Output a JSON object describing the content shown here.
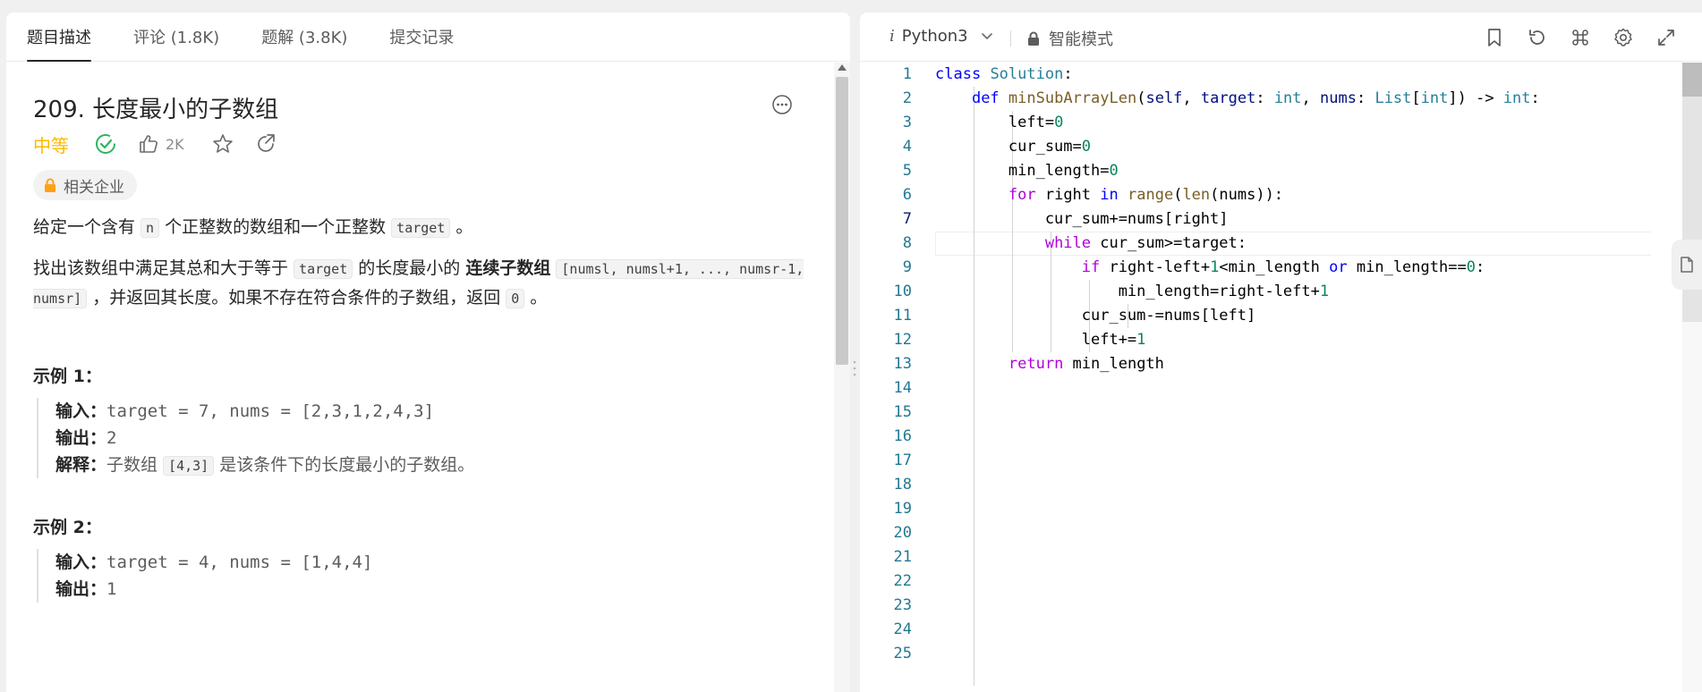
{
  "tabs": [
    {
      "label": "题目描述"
    },
    {
      "label": "评论 (1.8K)"
    },
    {
      "label": "题解 (3.8K)"
    },
    {
      "label": "提交记录"
    }
  ],
  "problem": {
    "title": "209. 长度最小的子数组",
    "difficulty": "中等",
    "difficulty_color": "#ffb800",
    "likes": "2K",
    "company_tag": "相关企业",
    "desc1_a": "给定一个含有 ",
    "desc1_code1": "n",
    "desc1_b": " 个正整数的数组和一个正整数 ",
    "desc1_code2": "target",
    "desc1_c": " 。",
    "desc2_a": "找出该数组中满足其总和大于等于 ",
    "desc2_code1": "target",
    "desc2_b": " 的长度最小的 ",
    "desc2_bold": "连续子数组",
    "desc2_code2": "[numsl, numsl+1, ..., numsr-1, numsr]",
    "desc2_c": " ，并返回其长度。如果不存在符合条件的子数组，返回 ",
    "desc2_code3": "0",
    "desc2_d": " 。"
  },
  "examples": [
    {
      "title": "示例 1：",
      "input_label": "输入：",
      "input": "target = 7, nums = [2,3,1,2,4,3]",
      "output_label": "输出：",
      "output": "2",
      "explain_label": "解释：",
      "explain_a": "子数组 ",
      "explain_code": "[4,3]",
      "explain_b": " 是该条件下的长度最小的子数组。"
    },
    {
      "title": "示例 2：",
      "input_label": "输入：",
      "input": "target = 4, nums = [1,4,4]",
      "output_label": "输出：",
      "output": "1"
    }
  ],
  "editor": {
    "language": "Python3",
    "mode": "智能模式",
    "line_numbers": [
      "1",
      "2",
      "3",
      "4",
      "5",
      "6",
      "7",
      "8",
      "9",
      "10",
      "11",
      "12",
      "13",
      "14",
      "15",
      "16",
      "17",
      "18",
      "19",
      "20",
      "21",
      "22",
      "23",
      "24",
      "25"
    ]
  }
}
